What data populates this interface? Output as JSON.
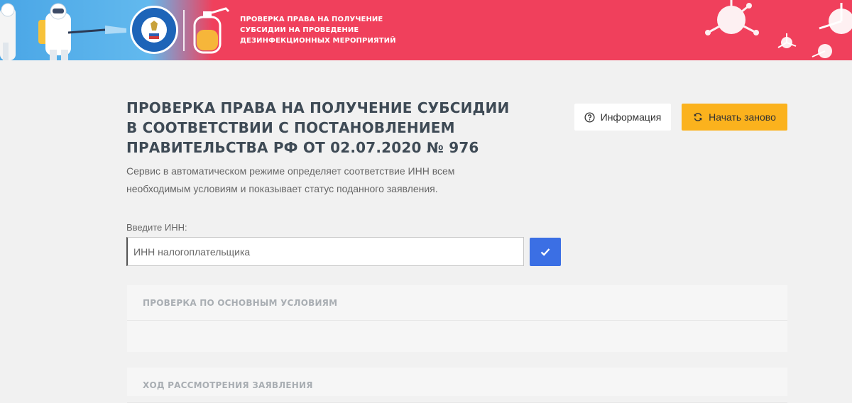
{
  "banner": {
    "title": "ПРОВЕРКА ПРАВА НА ПОЛУЧЕНИЕ СУБСИДИИ НА ПРОВЕДЕНИЕ ДЕЗИНФЕКЦИОННЫХ МЕРОПРИЯТИЙ",
    "colors": {
      "red": "#f0405c",
      "blue": "#4aa6e6"
    }
  },
  "main": {
    "title": "ПРОВЕРКА ПРАВА НА ПОЛУЧЕНИЕ СУБСИДИИ В СООТВЕТСТВИИ С ПОСТАНОВЛЕНИЕМ ПРАВИТЕЛЬСТВА РФ ОТ 02.07.2020 № 976",
    "description": "Сервис в автоматическом режиме определяет соответствие ИНН всем необходимым условиям и показывает статус поданного заявления."
  },
  "buttons": {
    "info_label": "Информация",
    "restart_label": "Начать заново"
  },
  "inn": {
    "label": "Введите ИНН:",
    "value": "",
    "placeholder": "ИНН налогоплательщика"
  },
  "panels": {
    "main_conditions": "ПРОВЕРКА ПО ОСНОВНЫМ УСЛОВИЯМ",
    "application_progress": "ХОД РАССМОТРЕНИЯ ЗАЯВЛЕНИЯ"
  },
  "icons": {
    "info": "question-circle-icon",
    "restart": "refresh-icon",
    "submit": "checkmark-icon"
  }
}
